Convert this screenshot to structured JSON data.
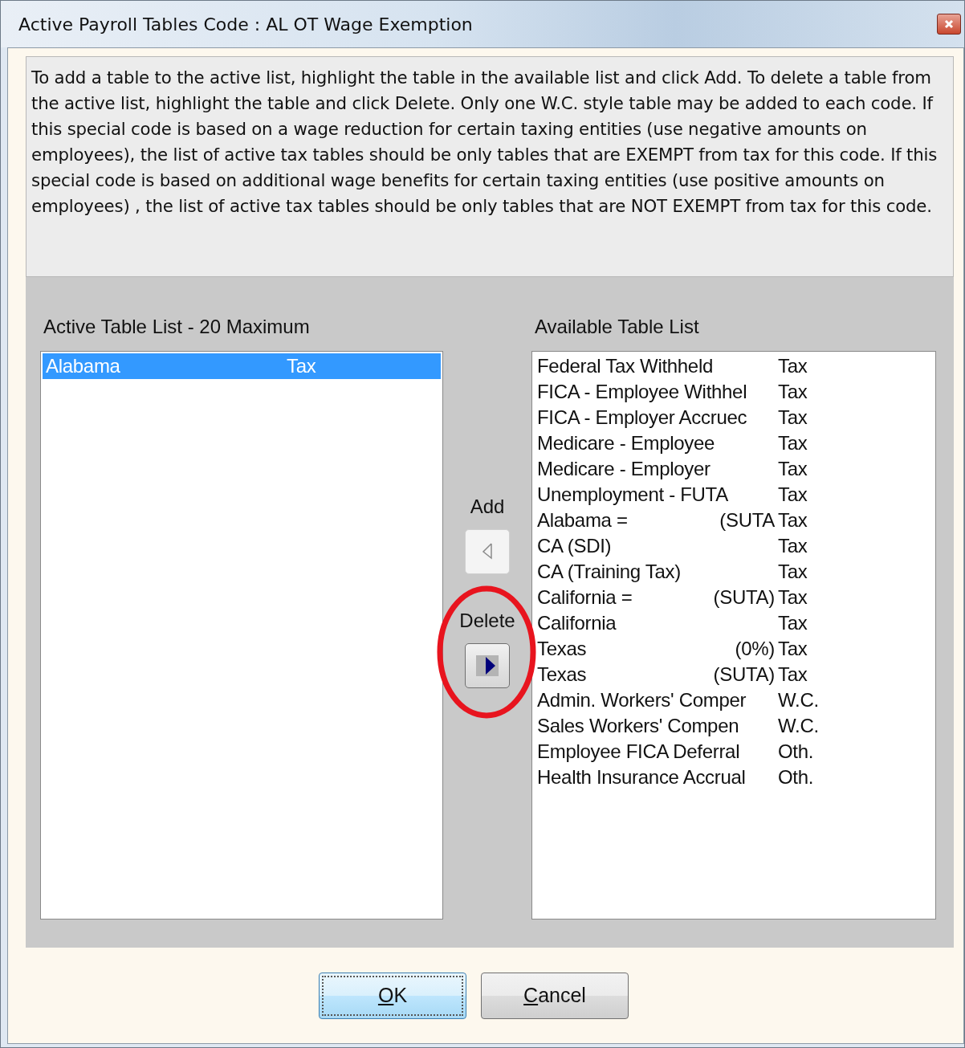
{
  "window": {
    "title": "Active Payroll Tables Code : AL OT Wage Exemption"
  },
  "instructions": "To add a table to the active list, highlight the table in the available list and click Add.  To delete a table from the active list, highlight the table and click Delete.  Only one W.C. style table may be added to each code.  If this special code is based on a wage reduction for certain taxing entities (use negative amounts on employees), the list of active tax tables should be only tables that are EXEMPT from tax for this code.  If this special code is based on additional wage benefits for certain taxing entities  (use positive amounts on employees) , the list of active tax tables should be only tables that are NOT EXEMPT from tax for this code.",
  "active_list": {
    "label": "Active Table List - 20 Maximum",
    "rows": [
      {
        "name": "Alabama",
        "type": "Tax",
        "selected": true
      }
    ]
  },
  "add": {
    "label": "Add",
    "disabled": true
  },
  "delete": {
    "label": "Delete",
    "disabled": false
  },
  "available_list": {
    "label": "Available Table List",
    "rows": [
      {
        "name": "Federal Tax Withheld",
        "type": "Tax",
        "selected": false
      },
      {
        "name": "FICA - Employee Withhel",
        "type": "Tax",
        "selected": false
      },
      {
        "name": "FICA - Employer Accruec",
        "type": "Tax",
        "selected": false
      },
      {
        "name": "Medicare - Employee",
        "type": "Tax",
        "selected": false
      },
      {
        "name": "Medicare - Employer",
        "type": "Tax",
        "selected": false
      },
      {
        "name": "Unemployment - FUTA",
        "type": "Tax",
        "selected": false
      },
      {
        "name": "Alabama =",
        "qualifier": "(SUTA",
        "type": "Tax",
        "selected": false
      },
      {
        "name": "CA (SDI)",
        "type": "Tax",
        "selected": false
      },
      {
        "name": "CA (Training Tax)",
        "type": "Tax",
        "selected": false
      },
      {
        "name": "California =",
        "qualifier": "(SUTA)",
        "type": "Tax",
        "selected": false
      },
      {
        "name": "California",
        "type": "Tax",
        "selected": false
      },
      {
        "name": "Texas",
        "qualifier": "(0%)",
        "type": "Tax",
        "selected": false
      },
      {
        "name": "Texas",
        "qualifier": "(SUTA)",
        "type": "Tax",
        "selected": false
      },
      {
        "name": "Admin. Workers' Comper",
        "type": "W.C.",
        "selected": false
      },
      {
        "name": "Sales  Workers' Compen",
        "type": "W.C.",
        "selected": false
      },
      {
        "name": "Employee FICA Deferral",
        "type": "Oth.",
        "selected": false
      },
      {
        "name": "Health Insurance Accrual",
        "type": "Oth.",
        "selected": false
      }
    ]
  },
  "buttons": [
    {
      "label": "OK",
      "default": true
    },
    {
      "label": "Cancel",
      "default": false
    }
  ]
}
